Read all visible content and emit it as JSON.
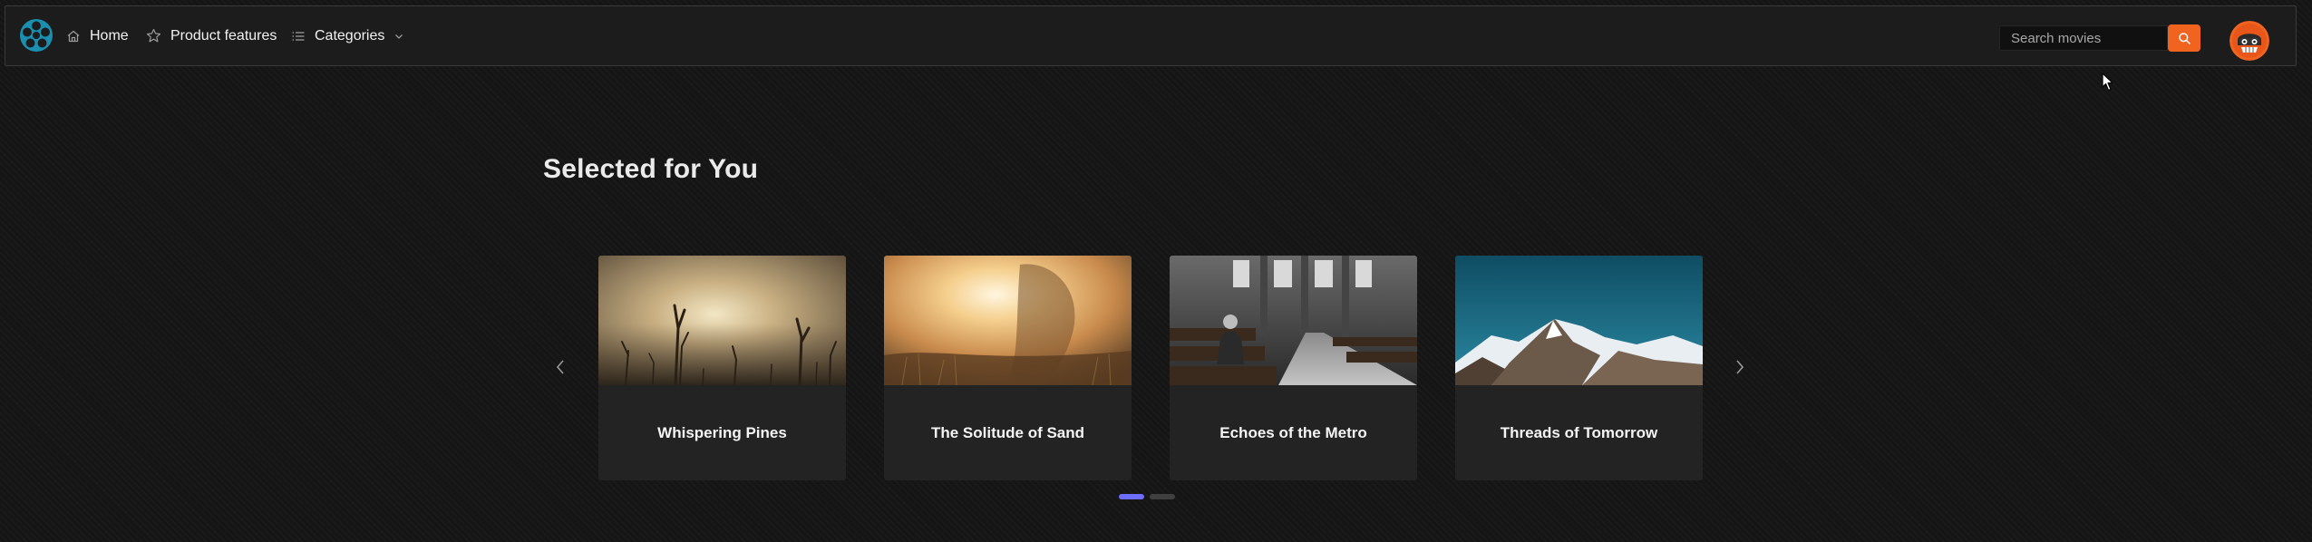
{
  "nav": {
    "home_label": "Home",
    "features_label": "Product features",
    "categories_label": "Categories",
    "icons": {
      "logo": "film-reel-icon",
      "home": "home-icon",
      "features": "star-icon",
      "categories": "list-icon",
      "dropdown": "chevron-down-icon",
      "search": "search-icon",
      "avatar": "user-avatar"
    }
  },
  "search": {
    "placeholder": "Search movies",
    "value": ""
  },
  "main": {
    "section_title": "Selected for You",
    "cards": [
      {
        "title": "Whispering Pines"
      },
      {
        "title": "The Solitude of Sand"
      },
      {
        "title": "Echoes of the Metro"
      },
      {
        "title": "Threads of Tomorrow"
      }
    ],
    "pagination": {
      "pages": 2,
      "active": 1
    }
  },
  "colors": {
    "accent": "#f06420",
    "logo": "#1a8fb0",
    "active_dot": "#6d6dff",
    "background": "#151515",
    "card": "#232323"
  }
}
